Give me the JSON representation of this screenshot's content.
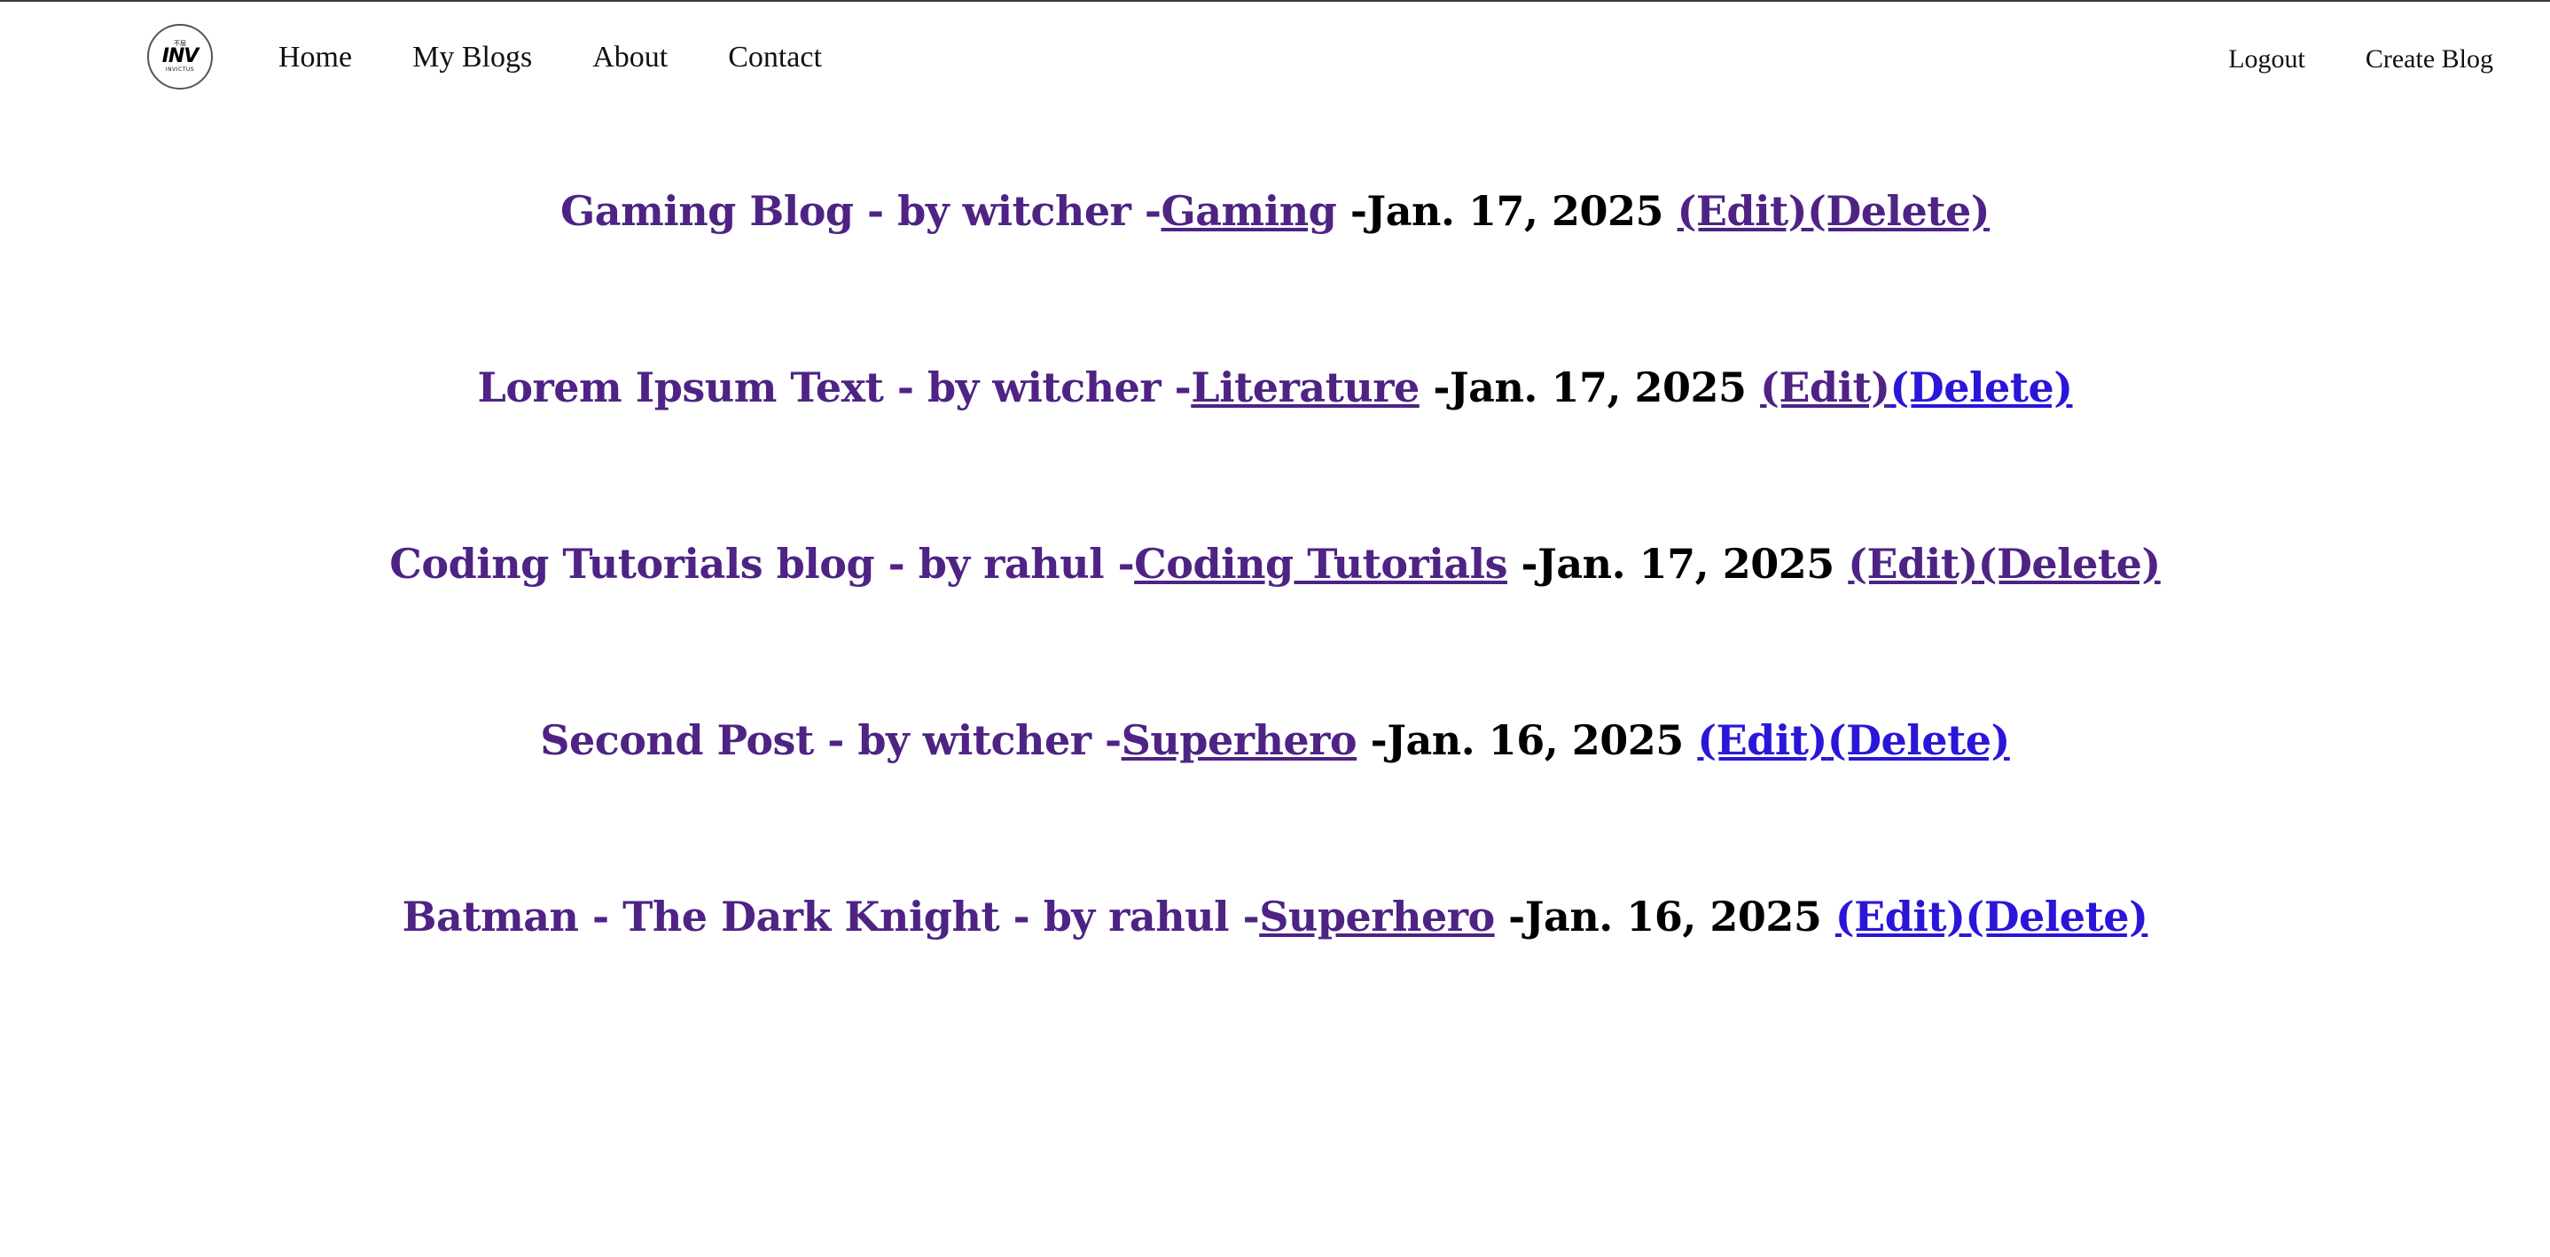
{
  "logo": {
    "small_text": "不屈",
    "main_text": "INV",
    "sub_text": "INVICTUS"
  },
  "nav": {
    "left": [
      "Home",
      "My Blogs",
      "About",
      "Contact"
    ],
    "right": [
      "Logout",
      "Create Blog"
    ]
  },
  "colors": {
    "visited_link": "#4e2384",
    "unvisited_link": "#2a16d8",
    "text": "#000000"
  },
  "posts": [
    {
      "title": "Gaming Blog - by witcher -",
      "category": "Gaming",
      "date": " -Jan. 17, 2025 ",
      "edit": "(Edit)",
      "delete": "(Delete)",
      "edit_visited": true,
      "delete_visited": true
    },
    {
      "title": "Lorem Ipsum Text - by witcher -",
      "category": "Literature",
      "date": " -Jan. 17, 2025 ",
      "edit": "(Edit)",
      "delete": "(Delete)",
      "edit_visited": true,
      "delete_visited": false
    },
    {
      "title": "Coding Tutorials blog - by rahul -",
      "category": "Coding Tutorials",
      "date": " -Jan. 17, 2025 ",
      "edit": "(Edit)",
      "delete": "(Delete)",
      "edit_visited": true,
      "delete_visited": true
    },
    {
      "title": "Second Post - by witcher -",
      "category": "Superhero",
      "date": " -Jan. 16, 2025 ",
      "edit": "(Edit)",
      "delete": "(Delete)",
      "edit_visited": false,
      "delete_visited": false
    },
    {
      "title": "Batman - The Dark Knight - by rahul -",
      "category": "Superhero",
      "date": " -Jan. 16, 2025 ",
      "edit": "(Edit)",
      "delete": "(Delete)",
      "edit_visited": false,
      "delete_visited": false
    }
  ]
}
